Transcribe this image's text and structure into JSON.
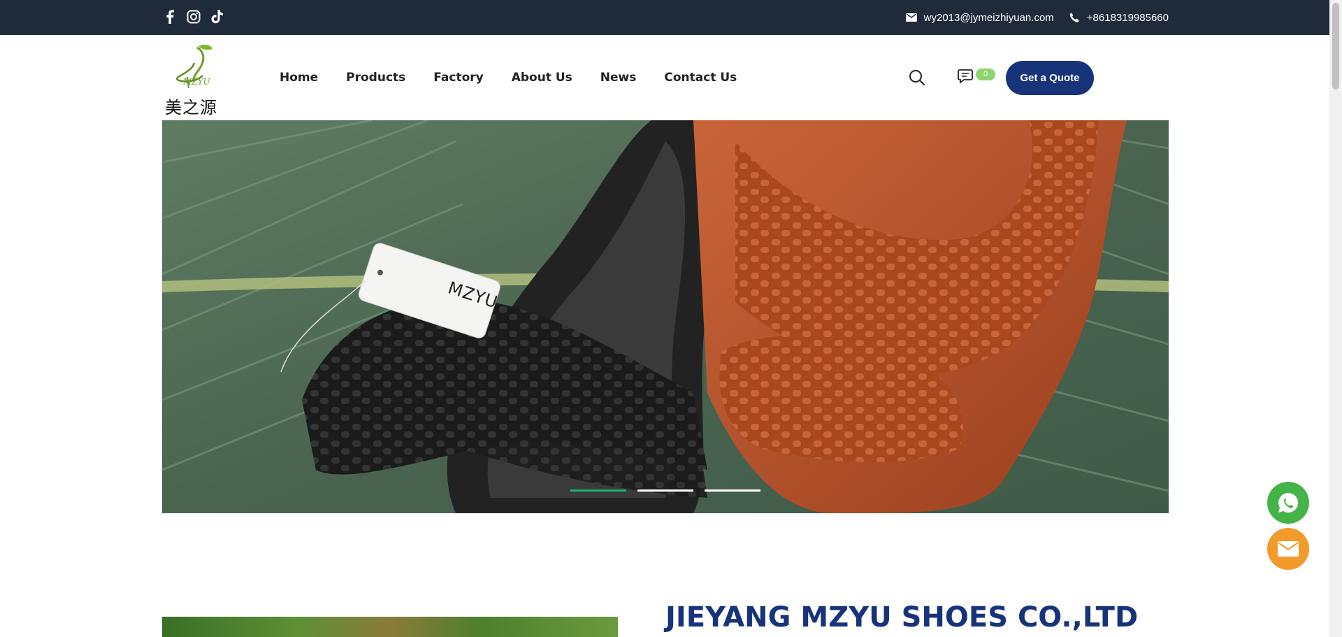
{
  "topbar": {
    "social": [
      {
        "icon": "facebook-icon"
      },
      {
        "icon": "instagram-icon"
      },
      {
        "icon": "tiktok-icon"
      }
    ],
    "email": "wy2013@jymeizhiyuan.com",
    "phone": "+8618319985660"
  },
  "header": {
    "logo": {
      "brand_en": "MZYU",
      "brand_cn": "美之源"
    },
    "nav": [
      "Home",
      "Products",
      "Factory",
      "About Us",
      "News",
      "Contact Us"
    ],
    "message_count": "0",
    "quote_label": "Get a Quote"
  },
  "banner": {
    "tag_text": "MZYU",
    "slide_count": 3,
    "active_slide": 1
  },
  "company": {
    "title": "JIEYANG MZYU SHOES CO.,LTD"
  },
  "colors": {
    "topbar_bg": "#1f2a3a",
    "brand_navy": "#17337a",
    "accent_green": "#1fb36e",
    "badge_green": "#8ed36e",
    "whatsapp_green": "#44b348",
    "mail_orange": "#f39a2d"
  }
}
